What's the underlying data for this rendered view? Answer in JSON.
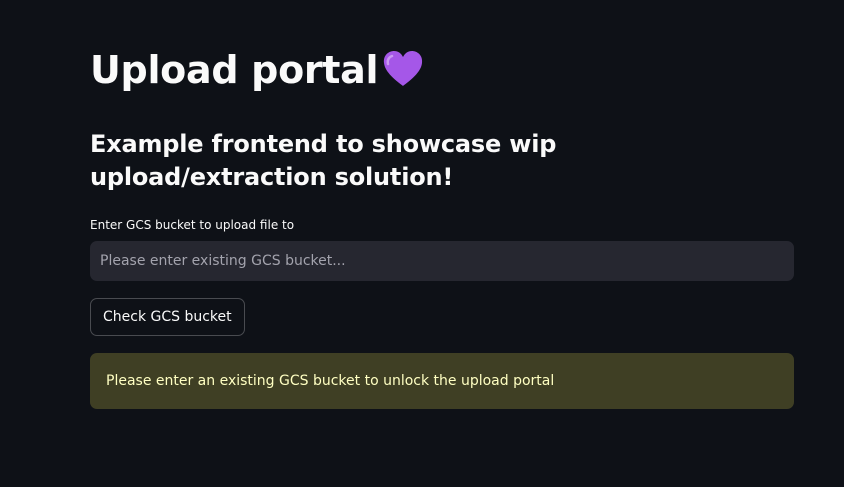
{
  "header": {
    "title": "Upload portal",
    "title_icon": "purple-heart-icon",
    "subtitle": "Example frontend to showcase wip upload/extraction solution!"
  },
  "form": {
    "bucket_label": "Enter GCS bucket to upload file to",
    "bucket_value": "",
    "bucket_placeholder": "Please enter existing GCS bucket...",
    "check_button_label": "Check GCS bucket"
  },
  "alert": {
    "message": "Please enter an existing GCS bucket to unlock the upload portal",
    "color": "#3f3f24",
    "text_color": "#ffffc2"
  },
  "colors": {
    "background": "#0e1117",
    "input_background": "#262730",
    "heart": "#a557e8"
  }
}
